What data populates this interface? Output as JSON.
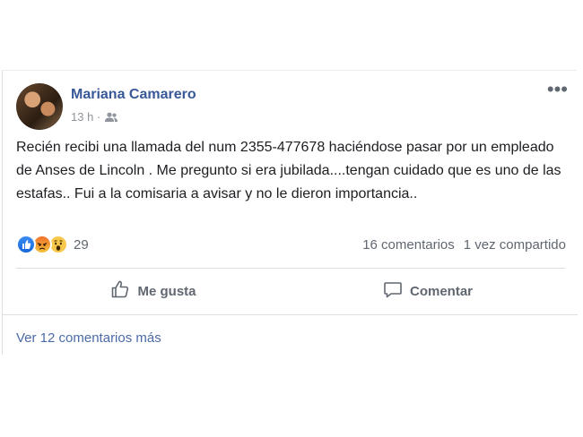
{
  "post": {
    "author": "Mariana Camarero",
    "timestamp": "13 h ·",
    "audience_icon": "friends-icon",
    "more_icon": "•••",
    "text": "Recién recibi una llamada del num 2355-477678 haciéndose pasar por un empleado de Anses de Lincoln . Me pregunto si era jubilada....tengan cuidado que es uno de las estafas.. Fui a la comisaria a avisar y no le dieron importancia..",
    "reactions": {
      "icons": [
        "like-icon",
        "angry-icon",
        "wow-icon"
      ],
      "count": "29"
    },
    "comments_count": "16 comentarios",
    "shares_count": "1 vez compartido",
    "actions": {
      "like": "Me gusta",
      "comment": "Comentar"
    },
    "view_more": "Ver 12 comentarios más"
  },
  "colors": {
    "link": "#385898",
    "secondary": "#606770",
    "like_blue": "#1667d8"
  }
}
